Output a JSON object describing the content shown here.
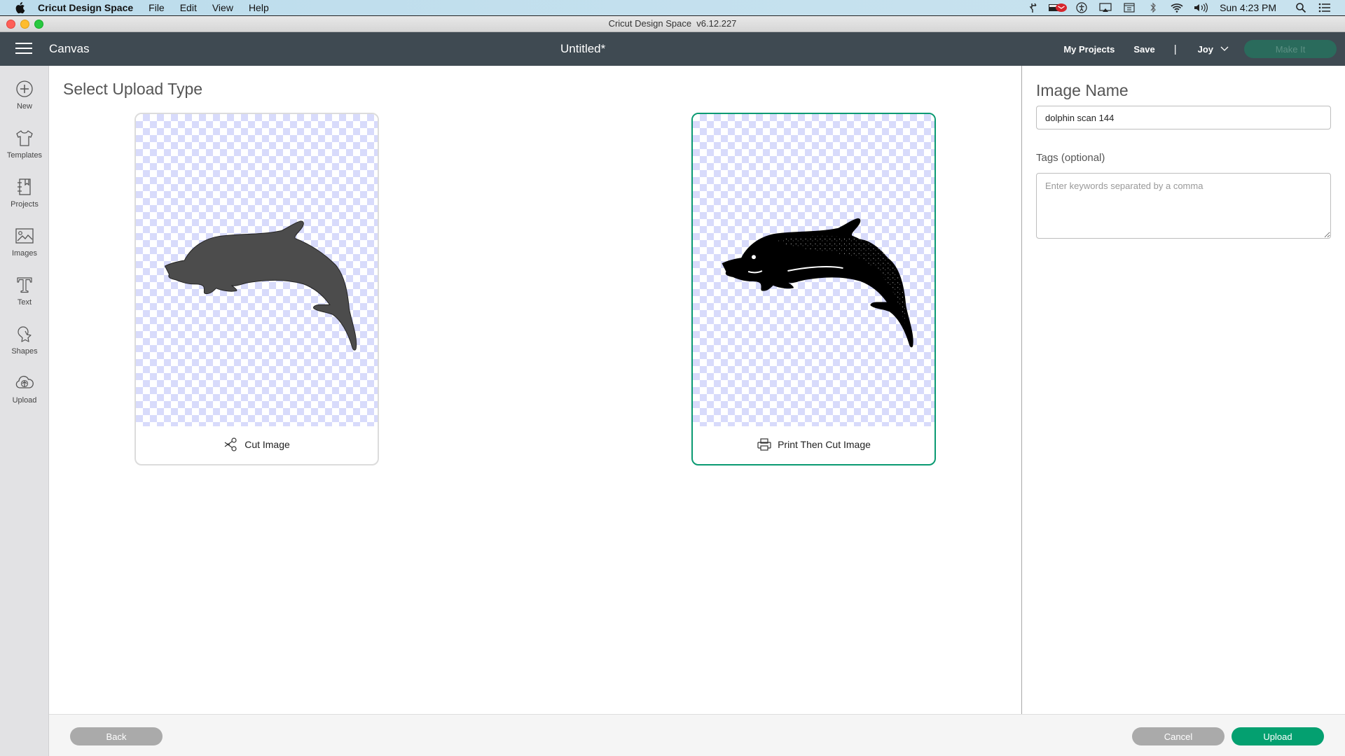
{
  "menubar": {
    "app_name": "Cricut Design Space",
    "menus": [
      "File",
      "Edit",
      "View",
      "Help"
    ],
    "status_icons": [
      "stamp-icon",
      "mail-notification-icon",
      "accessibility-icon",
      "airplay-icon",
      "keyboard-viewer-icon",
      "bluetooth-icon",
      "wifi-icon",
      "volume-icon"
    ],
    "clock": "Sun 4:23 PM",
    "right_icons": [
      "spotlight-search-icon",
      "notification-center-icon"
    ]
  },
  "window": {
    "title": "Cricut Design Space  v6.12.227"
  },
  "header": {
    "section": "Canvas",
    "document_title": "Untitled*",
    "my_projects_label": "My Projects",
    "save_label": "Save",
    "separator": "|",
    "user_name": "Joy",
    "make_it_label": "Make It"
  },
  "sidebar": {
    "items": [
      {
        "label": "New",
        "icon": "plus-circle-icon"
      },
      {
        "label": "Templates",
        "icon": "tshirt-icon"
      },
      {
        "label": "Projects",
        "icon": "notebook-icon"
      },
      {
        "label": "Images",
        "icon": "image-icon"
      },
      {
        "label": "Text",
        "icon": "text-icon"
      },
      {
        "label": "Shapes",
        "icon": "shapes-icon"
      },
      {
        "label": "Upload",
        "icon": "cloud-upload-icon"
      }
    ]
  },
  "main": {
    "heading": "Select Upload Type",
    "options": [
      {
        "label": "Cut Image",
        "icon": "scissors-icon",
        "selected": false
      },
      {
        "label": "Print Then Cut Image",
        "icon": "printer-icon",
        "selected": true
      }
    ]
  },
  "details": {
    "name_label": "Image Name",
    "name_value": "dolphin scan 144",
    "tags_label": "Tags (optional)",
    "tags_placeholder": "Enter keywords separated by a comma",
    "tags_value": ""
  },
  "footer": {
    "back_label": "Back",
    "cancel_label": "Cancel",
    "upload_label": "Upload"
  },
  "colors": {
    "header_bg": "#3f4a52",
    "accent_green": "#04a070",
    "selected_border": "#0a9a72",
    "checker": "#d8dbfb",
    "disabled_button": "#aaaaaa"
  }
}
